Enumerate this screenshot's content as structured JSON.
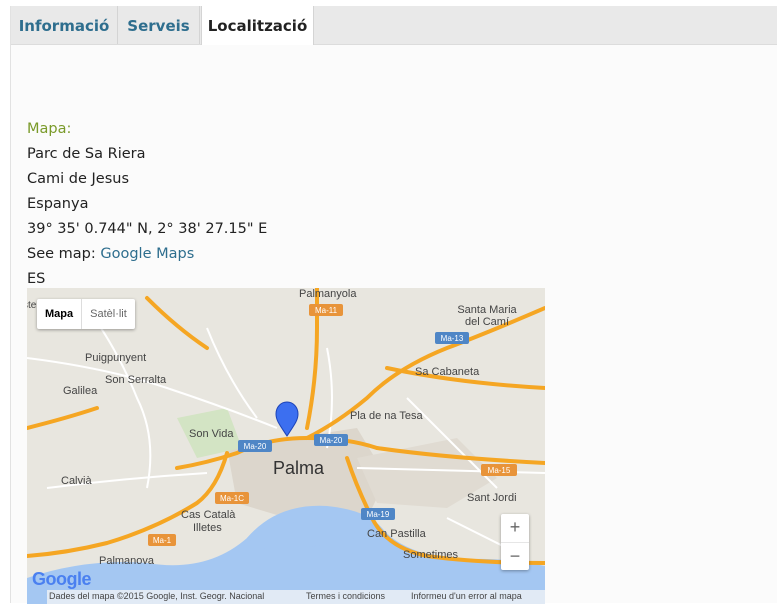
{
  "tabs": [
    {
      "label": "Informació",
      "active": false
    },
    {
      "label": "Serveis",
      "active": false
    },
    {
      "label": "Localització",
      "active": true
    }
  ],
  "location": {
    "heading": "Mapa:",
    "name": "Parc de Sa Riera",
    "street": "Cami de Jesus",
    "country": "Espanya",
    "coordinates": "39° 35' 0.744\" N, 2° 38' 27.15\" E",
    "see_map_prefix": "See map: ",
    "see_map_link": "Google Maps",
    "country_code": "ES"
  },
  "map": {
    "type_map": "Mapa",
    "type_satellite": "Satèl·lit",
    "zoom_in": "+",
    "zoom_out": "−",
    "logo": "Google",
    "attribution": "Dades del mapa ©2015 Google, Inst. Geogr. Nacional",
    "terms": "Termes i condicions",
    "report": "Informeu d'un error al mapa",
    "places": {
      "palmanyola": "Palmanyola",
      "santa_maria": "Santa Maria",
      "del_cami": "del Camí",
      "puigpunyent": "Puigpunyent",
      "son_serralta": "Son Serralta",
      "galilea": "Galilea",
      "sa_cabaneta": "Sa Cabaneta",
      "pla_de_na_tesa": "Pla de na Tesa",
      "son_vida": "Son Vida",
      "palma": "Palma",
      "calvia": "Calvià",
      "sant_jordi": "Sant Jordi",
      "cas_catala": "Cas Català",
      "illetes": "Illetes",
      "can_pastilla": "Can Pastilla",
      "sometimes": "Sometimes",
      "palmanova": "Palmanova",
      "edge": "ste"
    },
    "roads": {
      "ma11": "Ma-11",
      "ma13": "Ma-13",
      "ma20a": "Ma-20",
      "ma20b": "Ma-20",
      "ma15": "Ma-15",
      "ma1c": "Ma-1C",
      "ma1": "Ma-1",
      "ma19": "Ma-19"
    },
    "colors": {
      "land": "#e8e6df",
      "water": "#a4c7f2",
      "highway": "#f5a623",
      "urban": "#dcd6cc",
      "marker": "#3c6ff0"
    }
  }
}
